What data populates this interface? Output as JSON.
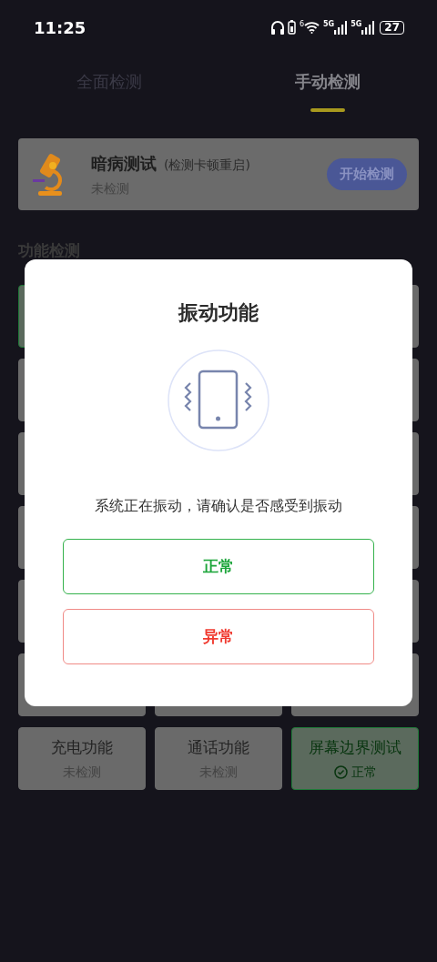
{
  "status_bar": {
    "time": "11:25",
    "wifi_label": "6",
    "networks": [
      "5G",
      "5G"
    ],
    "battery": "27"
  },
  "tabs": [
    {
      "label": "全面检测",
      "selected": false
    },
    {
      "label": "手动检测",
      "selected": true
    }
  ],
  "hidden_test": {
    "title": "暗病测试",
    "note": "(检测卡顿重启)",
    "status": "未检测",
    "button": "开始检测"
  },
  "section_title": "功能检测",
  "tile_rows": [
    {
      "left": {
        "passed": true
      },
      "right": {
        "passed": false
      }
    },
    {
      "left": {
        "passed": false
      },
      "right": {
        "passed": false
      }
    },
    {
      "left": {
        "passed": false
      },
      "right": {
        "passed": false
      }
    },
    {
      "left": {
        "passed": false
      },
      "right": {
        "passed": false
      }
    },
    {
      "left": {
        "passed": false
      },
      "right": {
        "passed": false
      }
    },
    {
      "left": {
        "passed": false
      },
      "middle": {
        "passed": false
      },
      "right": {
        "passed": false
      }
    },
    {
      "left": {
        "passed": false,
        "name": "充电功能",
        "status": "未检测"
      },
      "middle": {
        "passed": false,
        "name": "通话功能",
        "status": "未检测"
      },
      "right": {
        "passed": true,
        "name": "屏幕边界测试",
        "status": "正常"
      }
    }
  ],
  "dialog": {
    "title": "振动功能",
    "message": "系统正在振动，请确认是否感受到振动",
    "buttons": [
      {
        "label": "正常",
        "kind": "ok"
      },
      {
        "label": "异常",
        "kind": "fail"
      }
    ]
  }
}
